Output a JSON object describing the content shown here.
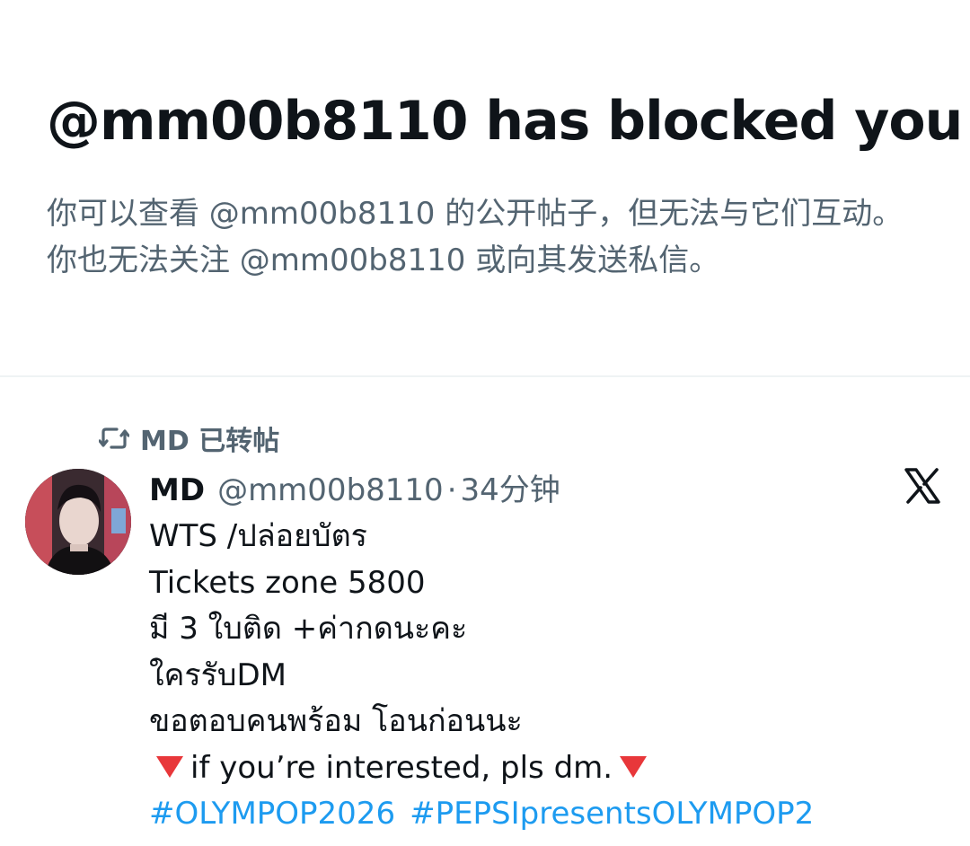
{
  "block_notice": {
    "title": "@mm00b8110 has blocked you",
    "description": "你可以查看 @mm00b8110 的公开帖子，但无法与它们互动。你也无法关注 @mm00b8110 或向其发送私信。"
  },
  "retweet": {
    "icon": "retweet-icon",
    "label": "MD 已转帖"
  },
  "tweet": {
    "author_name": "MD",
    "author_handle": "@mm00b8110",
    "separator": "·",
    "time_ago": "34分钟",
    "logo_icon": "x-logo-icon",
    "lines": [
      "WTS /ปล่อยบัตร",
      "Tickets zone 5800",
      "มี 3 ใบติด  +ค่ากดนะคะ",
      "ใครรับDM",
      "ขอตอบคนพร้อม โอนก่อนนะ"
    ],
    "interest_line": "if you’re interested, pls dm.",
    "interest_icon": "red-triangle-down-icon",
    "hashtags": [
      "#OLYMPOP2026",
      "#PEPSIpresentsOLYMPOP2"
    ]
  },
  "colors": {
    "text_primary": "#0f1419",
    "text_secondary": "#536471",
    "link": "#1d9bf0",
    "triangle": "#e8373a"
  }
}
